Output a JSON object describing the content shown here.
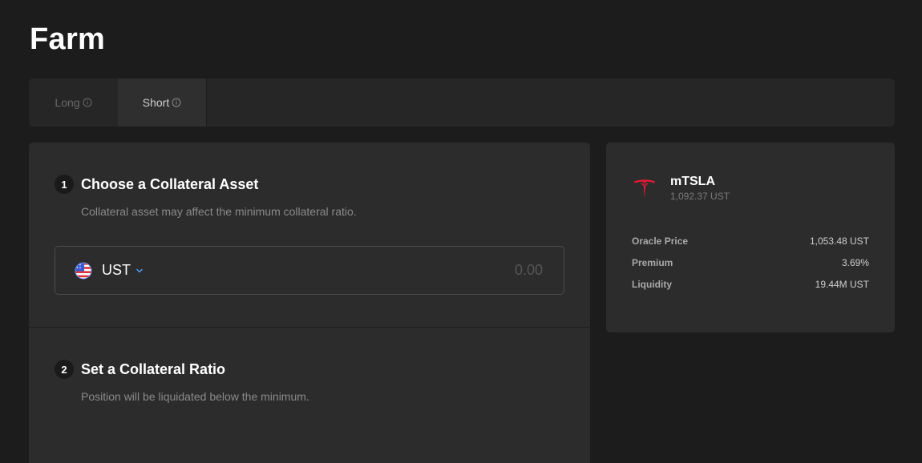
{
  "page": {
    "title": "Farm"
  },
  "tabs": [
    {
      "label": "Long",
      "active": false
    },
    {
      "label": "Short",
      "active": true
    }
  ],
  "steps": [
    {
      "number": "1",
      "title": "Choose a Collateral Asset",
      "description": "Collateral asset may affect the minimum collateral ratio."
    },
    {
      "number": "2",
      "title": "Set a Collateral Ratio",
      "description": "Position will be liquidated below the minimum."
    }
  ],
  "collateral_input": {
    "asset_symbol": "UST",
    "placeholder": "0.00",
    "value": ""
  },
  "asset_info": {
    "name": "mTSLA",
    "price": "1,092.37 UST",
    "stats": [
      {
        "label": "Oracle Price",
        "value": "1,053.48 UST"
      },
      {
        "label": "Premium",
        "value": "3.69%"
      },
      {
        "label": "Liquidity",
        "value": "19.44M UST"
      }
    ]
  },
  "icons": {
    "info": "info-icon",
    "flag": "us-flag-icon",
    "chevron": "chevron-down-icon",
    "asset_logo": "tesla-logo-icon"
  },
  "colors": {
    "background": "#1c1c1c",
    "card": "#2c2c2c",
    "accent": "#4fa0f7",
    "tesla_red": "#e31937"
  }
}
